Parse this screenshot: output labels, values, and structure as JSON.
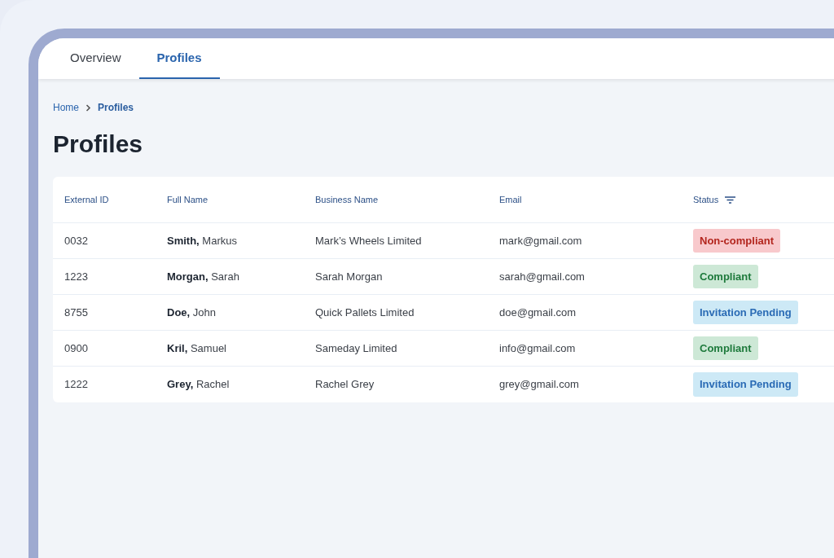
{
  "tabs": [
    {
      "label": "Overview",
      "selected": false
    },
    {
      "label": "Profiles",
      "selected": true
    }
  ],
  "breadcrumb": [
    "Home",
    "Profiles"
  ],
  "page_title": "Profiles",
  "table": {
    "columns": [
      "External ID",
      "Full Name",
      "Business Name",
      "Email",
      "Status"
    ],
    "rows": [
      {
        "external_id": "0032",
        "last_name": "Smith,",
        "first_name": "Markus",
        "business_name": "Mark’s Wheels Limited",
        "email": "mark@gmail.com",
        "status": {
          "label": "Non-compliant",
          "kind": "noncompliant"
        }
      },
      {
        "external_id": "1223",
        "last_name": "Morgan,",
        "first_name": "Sarah",
        "business_name": "Sarah Morgan",
        "email": "sarah@gmail.com",
        "status": {
          "label": "Compliant",
          "kind": "compliant"
        }
      },
      {
        "external_id": "8755",
        "last_name": "Doe,",
        "first_name": "John",
        "business_name": "Quick Pallets Limited",
        "email": "doe@gmail.com",
        "status": {
          "label": "Invitation Pending",
          "kind": "pending"
        }
      },
      {
        "external_id": "0900",
        "last_name": "Kril,",
        "first_name": "Samuel",
        "business_name": "Sameday Limited",
        "email": "info@gmail.com",
        "status": {
          "label": "Compliant",
          "kind": "compliant"
        }
      },
      {
        "external_id": "1222",
        "last_name": "Grey,",
        "first_name": "Rachel",
        "business_name": "Rachel Grey",
        "email": "grey@gmail.com",
        "status": {
          "label": "Invitation Pending",
          "kind": "pending"
        }
      }
    ]
  }
}
